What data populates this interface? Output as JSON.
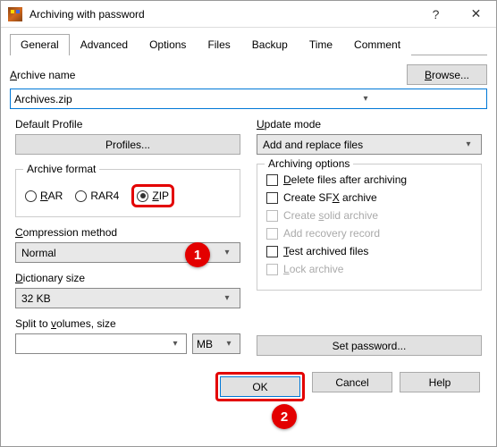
{
  "titlebar": {
    "title": "Archiving with password"
  },
  "tabs": {
    "general": "General",
    "advanced": "Advanced",
    "options": "Options",
    "files": "Files",
    "backup": "Backup",
    "time": "Time",
    "comment": "Comment"
  },
  "archive_name": {
    "label_pre": "",
    "label_u": "A",
    "label_post": "rchive name",
    "value": "Archives.zip",
    "browse_pre": "",
    "browse_u": "B",
    "browse_post": "rowse..."
  },
  "default_profile": {
    "label": "Default Profile",
    "button": "Profiles..."
  },
  "update_mode": {
    "label_u": "U",
    "label_post": "pdate mode",
    "value": "Add and replace files"
  },
  "archive_format": {
    "title": "Archive format",
    "rar_u": "R",
    "rar_post": "AR",
    "rar4": "RAR4",
    "zip_u": "Z",
    "zip_post": "IP"
  },
  "compression": {
    "label_u": "C",
    "label_post": "ompression method",
    "value": "Normal"
  },
  "dictionary": {
    "label_u": "D",
    "label_post": "ictionary size",
    "value": "32 KB"
  },
  "split": {
    "label_pre": "Split to ",
    "label_u": "v",
    "label_post": "olumes, size",
    "unit": "MB"
  },
  "archiving_options": {
    "title": "Archiving options",
    "delete_u": "D",
    "delete_post": "elete files after archiving",
    "sfx_pre": "Create SF",
    "sfx_u": "X",
    "sfx_post": " archive",
    "solid_pre": "Create ",
    "solid_u": "s",
    "solid_post": "olid archive",
    "recovery_pre": "Add recovery record",
    "test_u": "T",
    "test_post": "est archived files",
    "lock_u": "L",
    "lock_post": "ock archive"
  },
  "set_password": {
    "label": "Set password..."
  },
  "buttons": {
    "ok": "OK",
    "cancel": "Cancel",
    "help": "Help"
  },
  "badges": {
    "one": "1",
    "two": "2"
  }
}
